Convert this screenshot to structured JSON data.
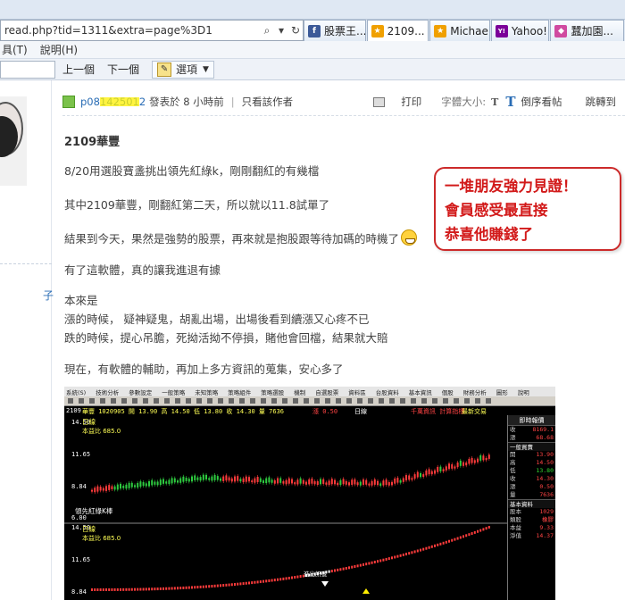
{
  "browser": {
    "address_url": "read.php?tid=1311&extra=page%3D1",
    "tabs": [
      {
        "label": "股票王...",
        "icon": "facebook-icon",
        "color": "#3b5998",
        "glyph": "f"
      },
      {
        "label": "2109...",
        "icon": "forum-icon",
        "color": "#f0a000",
        "glyph": "★",
        "active": true
      },
      {
        "label": "Michae...",
        "icon": "forum-icon",
        "color": "#f0a000",
        "glyph": "★"
      },
      {
        "label": "Yahoo!...",
        "icon": "yahoo-icon",
        "color": "#7b0099",
        "glyph": "Y!"
      },
      {
        "label": "蠶加園...",
        "icon": "site-icon",
        "color": "#d04aa0",
        "glyph": "◆"
      }
    ],
    "menu": [
      "具(T)",
      "說明(H)"
    ],
    "toolbar": {
      "prev": "上一個",
      "next": "下一個",
      "options": "選項"
    }
  },
  "post": {
    "author": "p081425012",
    "posted": "發表於 8 小時前",
    "view_author_only": "只看該作者",
    "print": "打印",
    "font_size": "字體大小:",
    "reverse": "倒序看帖",
    "jump": "跳轉到",
    "title": "2109華豐",
    "lines": [
      "8/20用選股寶盞挑出領先紅綠k，剛剛翻紅的有幾檔",
      "其中2109華豐，剛翻紅第二天，所以就以11.8試單了",
      "結果到今天，果然是強勢的股票，再來就是抱股跟等待加碼的時機了",
      "有了這軟體，真的讓我進退有據",
      "本來是",
      "漲的時候，  疑神疑鬼，胡亂出場，出場後看到續漲又心疼不已",
      "跌的時候，提心吊膽，死拗活拗不停損，賭他會回檔，結果就大賠",
      "現在，有軟體的輔助，再加上多方資訊的蒐集，安心多了"
    ],
    "callout": [
      "一堆朋友強力見證！",
      "會員感受最直接",
      "恭喜他賺錢了"
    ]
  },
  "sidebar": {
    "link": "子"
  },
  "stock_screenshot": {
    "menu": [
      "系統(S)",
      "技術分析",
      "參數設定",
      "一般策略",
      "未知策略",
      "策略組件",
      "策略選股",
      "機制",
      "自選股票",
      "資料區",
      "台股資料",
      "基本資訊",
      "個股",
      "財務分析",
      "圖形",
      "說明"
    ],
    "code": "2109",
    "quote": "華豐  1020905  開 13.90  高 14.50  低 13.80  收 14.30  量 7636",
    "alt1": "漲 0.50",
    "alt2": "日線",
    "alt3": "千萬資訊   計算指標",
    "alt4": "最新交易",
    "side_head": "即時報價",
    "side_rows": [
      {
        "k": "收",
        "v": "8169.1"
      },
      {
        "k": "漲",
        "v": "68.68"
      }
    ],
    "side_sec": "一般買賣",
    "side_rows2": [
      {
        "k": "開",
        "v": "13.90"
      },
      {
        "k": "高",
        "v": "14.50"
      },
      {
        "k": "低",
        "v": "13.80"
      },
      {
        "k": "收",
        "v": "14.30"
      },
      {
        "k": "漲",
        "v": "0.50"
      },
      {
        "k": "量",
        "v": "7636"
      }
    ],
    "side_sec2": "基本資料",
    "side_rows3": [
      {
        "k": "股本",
        "v": "1029"
      },
      {
        "k": "類股",
        "v": "橡膠"
      },
      {
        "k": "本益",
        "v": "9.33"
      },
      {
        "k": "淨值",
        "v": "14.37"
      }
    ],
    "chart_labels": {
      "top_left": "日線",
      "ratio1": "本益比  685.0",
      "legend": "領先紅綠K棒",
      "price_hi": "14.50",
      "price_mid": "11.65",
      "price_lo": "8.84",
      "price_bot": "6.00",
      "bottom_left": "日線",
      "ratio2": "本益比  685.0",
      "bottom_hi": "14.50",
      "bottom_mid": "11.65",
      "bottom_lo": "8.84",
      "marker": "進出訊號"
    }
  },
  "colors": {
    "accent": "#2a6db5",
    "callout": "#d21a1a",
    "up": "#ff3b3b",
    "down": "#2ecc40"
  }
}
